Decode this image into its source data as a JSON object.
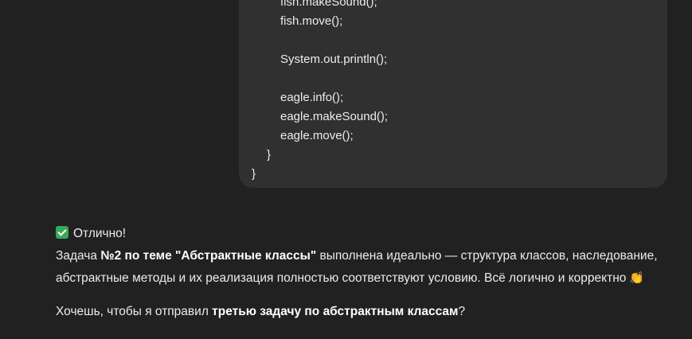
{
  "code_block": {
    "lines": [
      {
        "indent": 2,
        "text": "fish.makeSound();"
      },
      {
        "indent": 2,
        "text": "fish.move();"
      },
      {
        "indent": 0,
        "text": ""
      },
      {
        "indent": 2,
        "text": "System.out.println();"
      },
      {
        "indent": 0,
        "text": ""
      },
      {
        "indent": 2,
        "text": "eagle.info();"
      },
      {
        "indent": 2,
        "text": "eagle.makeSound();"
      },
      {
        "indent": 2,
        "text": "eagle.move();"
      },
      {
        "indent": 1,
        "text": "}"
      },
      {
        "indent": 0,
        "text": "}"
      }
    ]
  },
  "reply": {
    "status_icon": "check-icon",
    "status_text": "Отлично!",
    "p1_prefix": "Задача ",
    "p1_bold": "№2 по теме \"Абстрактные классы\"",
    "p1_suffix_line1": " выполнена идеально — структура классов, наследование,",
    "p1_line2": "абстрактные методы и их реализация полностью соответствуют условию. Всё логично и корректно",
    "p1_emoji": "👏",
    "p2_prefix": "Хочешь, чтобы я отправил ",
    "p2_bold": "третью задачу по абстрактным классам",
    "p2_suffix": "?"
  }
}
